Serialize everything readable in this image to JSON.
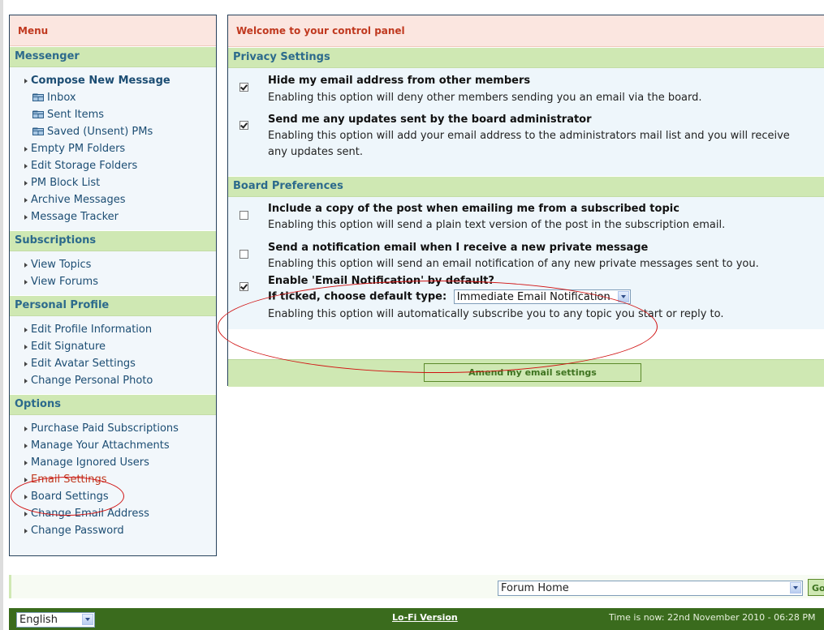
{
  "menu": {
    "title": "Menu",
    "messenger": {
      "heading": "Messenger",
      "items": [
        {
          "label": "Compose New Message",
          "kind": "bold"
        },
        {
          "label": "Inbox",
          "kind": "folder"
        },
        {
          "label": "Sent Items",
          "kind": "folder"
        },
        {
          "label": "Saved (Unsent) PMs",
          "kind": "folder"
        },
        {
          "label": "Empty PM Folders",
          "kind": "link"
        },
        {
          "label": "Edit Storage Folders",
          "kind": "link"
        },
        {
          "label": "PM Block List",
          "kind": "link"
        },
        {
          "label": "Archive Messages",
          "kind": "link"
        },
        {
          "label": "Message Tracker",
          "kind": "link"
        }
      ]
    },
    "subscriptions": {
      "heading": "Subscriptions",
      "items": [
        "View Topics",
        "View Forums"
      ]
    },
    "profile": {
      "heading": "Personal Profile",
      "items": [
        "Edit Profile Information",
        "Edit Signature",
        "Edit Avatar Settings",
        "Change Personal Photo"
      ]
    },
    "options": {
      "heading": "Options",
      "items": [
        "Purchase Paid Subscriptions",
        "Manage Your Attachments",
        "Manage Ignored Users",
        "Email Settings",
        "Board Settings",
        "Change Email Address",
        "Change Password"
      ],
      "active": "Email Settings"
    }
  },
  "panel": {
    "title": "Welcome to your control panel",
    "privacy": {
      "heading": "Privacy Settings",
      "hide_email": {
        "checked": true,
        "title": "Hide my email address from other members",
        "desc": "Enabling this option will deny other members sending you an email via the board."
      },
      "admin_updates": {
        "checked": true,
        "title": "Send me any updates sent by the board administrator",
        "desc1": "Enabling this option will add your email address to the administrators mail list and you will receive",
        "desc2": "any updates sent."
      }
    },
    "board": {
      "heading": "Board Preferences",
      "copy_post": {
        "checked": false,
        "title": "Include a copy of the post when emailing me from a subscribed topic",
        "desc": "Enabling this option will send a plain text version of the post in the subscription email."
      },
      "pm_notify": {
        "checked": false,
        "title": "Send a notification email when I receive a new private message",
        "desc": "Enabling this option will send an email notification of any new private messages sent to you."
      },
      "email_notify": {
        "checked": true,
        "title": "Enable 'Email Notification' by default?",
        "type_label": "If ticked, choose default type:",
        "type_value": "Immediate Email Notification",
        "desc": "Enabling this option will automatically subscribe you to any topic you start or reply to."
      }
    },
    "submit_label": "Amend my email settings"
  },
  "bottom": {
    "forum_jump": "Forum Home",
    "go_label": "Go",
    "language": "English",
    "lofi": "Lo-Fi Version",
    "time": "Time is now: 22nd November 2010 - 06:28 PM"
  },
  "colors": {
    "accent_red": "#c0391f",
    "section_green": "#cfe8b3",
    "footer_green": "#3a6b1d",
    "link_blue": "#1c4d73"
  }
}
